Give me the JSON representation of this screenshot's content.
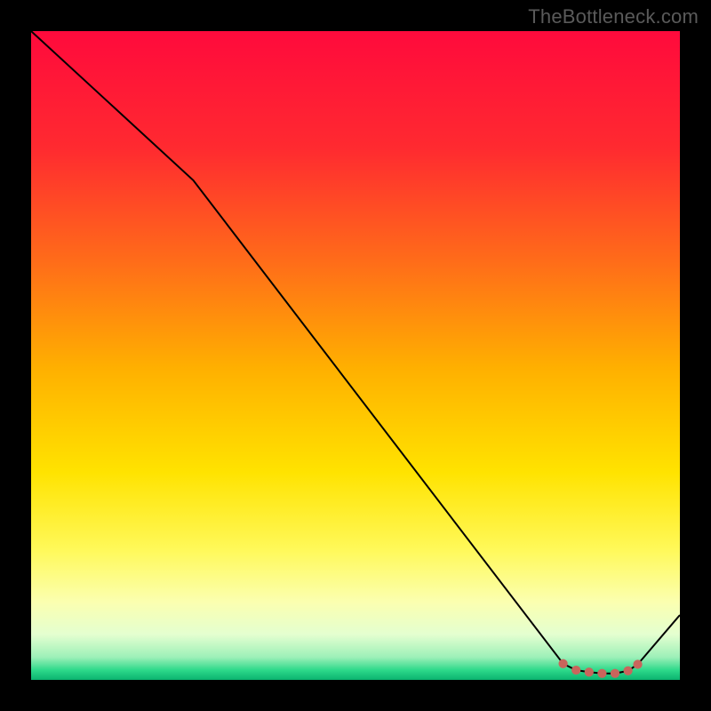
{
  "attribution": "TheBottleneck.com",
  "chart_data": {
    "type": "line",
    "title": "",
    "xlabel": "",
    "ylabel": "",
    "xlim": [
      0,
      100
    ],
    "ylim": [
      0,
      100
    ],
    "series": [
      {
        "name": "curve",
        "x": [
          0,
          25,
          82,
          84,
          86,
          88,
          90,
          92,
          93.5,
          100
        ],
        "y": [
          100,
          77,
          2.5,
          1.5,
          1.2,
          1.0,
          1.0,
          1.4,
          2.4,
          10
        ]
      }
    ],
    "markers": {
      "name": "dots",
      "x": [
        82,
        84,
        86,
        88,
        90,
        92,
        93.5
      ],
      "y": [
        2.5,
        1.5,
        1.2,
        1.0,
        1.0,
        1.4,
        2.4
      ]
    },
    "gradient": {
      "stops": [
        {
          "pos": 0.0,
          "color": "#ff0a3c"
        },
        {
          "pos": 0.18,
          "color": "#ff2a30"
        },
        {
          "pos": 0.35,
          "color": "#ff6a1a"
        },
        {
          "pos": 0.52,
          "color": "#ffb000"
        },
        {
          "pos": 0.68,
          "color": "#ffe300"
        },
        {
          "pos": 0.8,
          "color": "#fff95a"
        },
        {
          "pos": 0.88,
          "color": "#fbffb0"
        },
        {
          "pos": 0.93,
          "color": "#e4ffd0"
        },
        {
          "pos": 0.965,
          "color": "#9df0b8"
        },
        {
          "pos": 0.985,
          "color": "#2dd98a"
        },
        {
          "pos": 1.0,
          "color": "#0bb36f"
        }
      ]
    },
    "marker_color": "#c9655c",
    "line_color": "#000000"
  }
}
